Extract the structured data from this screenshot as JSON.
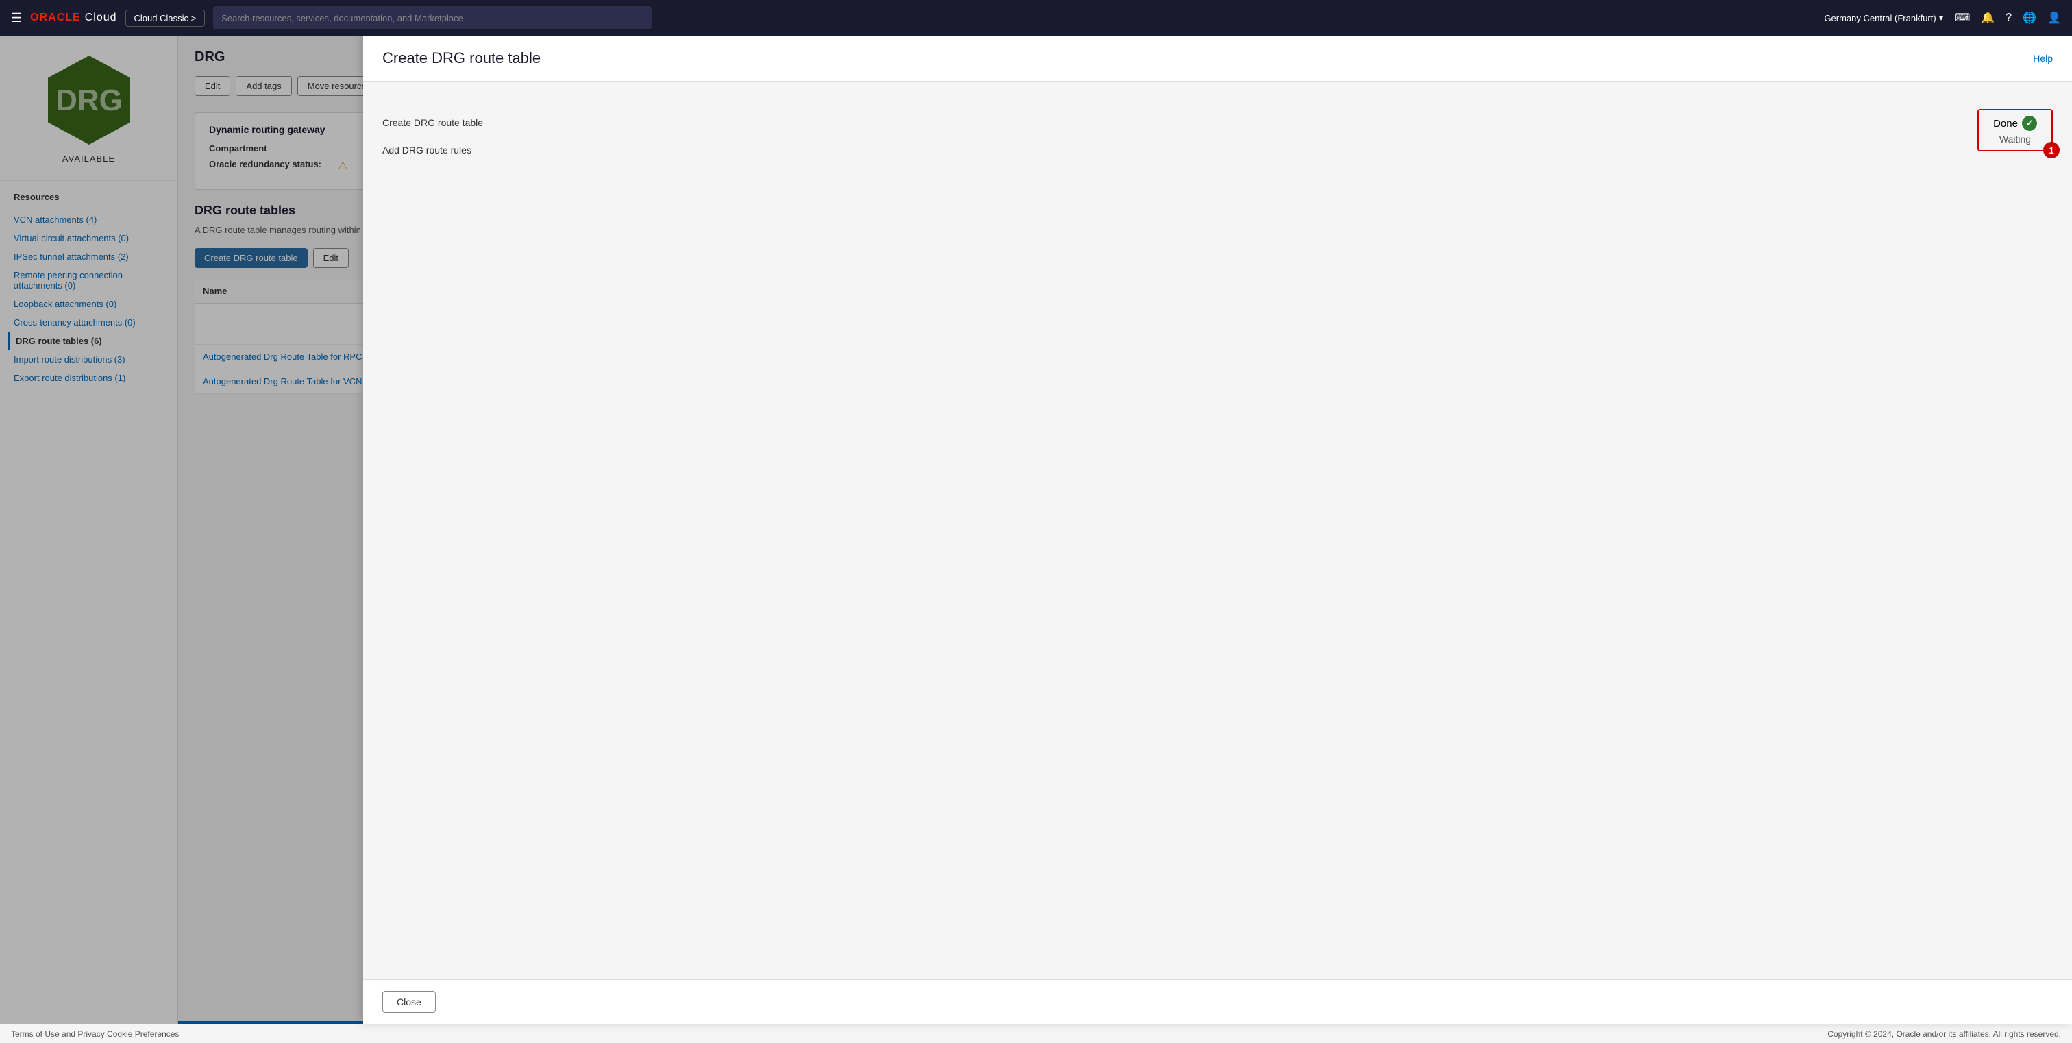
{
  "nav": {
    "hamburger_label": "☰",
    "oracle_label": "ORACLE",
    "cloud_label": "Cloud",
    "cloud_classic_label": "Cloud Classic >",
    "search_placeholder": "Search resources, services, documentation, and Marketplace",
    "region_label": "Germany Central (Frankfurt)",
    "region_chevron": "▾"
  },
  "sidebar": {
    "drg_label": "DRG",
    "status_label": "AVAILABLE",
    "resources_heading": "Resources",
    "links": [
      {
        "label": "VCN attachments (4)",
        "active": false
      },
      {
        "label": "Virtual circuit attachments (0)",
        "active": false
      },
      {
        "label": "IPSec tunnel attachments (2)",
        "active": false
      },
      {
        "label": "Remote peering connection attachments (0)",
        "active": false
      },
      {
        "label": "Loopback attachments (0)",
        "active": false
      },
      {
        "label": "Cross-tenancy attachments (0)",
        "active": false
      },
      {
        "label": "DRG route tables (6)",
        "active": true
      },
      {
        "label": "Import route distributions (3)",
        "active": false
      },
      {
        "label": "Export route distributions (1)",
        "active": false
      }
    ]
  },
  "content": {
    "page_title": "DRG",
    "action_buttons": [
      "Edit",
      "Add tags",
      "Move resource"
    ],
    "gateway_section": {
      "title": "Dynamic routing gateway",
      "compartment_label": "Compartment",
      "redundancy_label": "Oracle redundancy status:"
    },
    "route_tables": {
      "title": "DRG route tables",
      "description": "A DRG route table manages routing within a DRG, and is used to route traffic to resources of a certain type to use specific next hops.",
      "create_button": "Create DRG route table",
      "edit_button": "Edit",
      "table_headers": [
        "Name"
      ],
      "rows": [
        {
          "name": "Autogenerated Drg Route Table for RPC, VC, and IPSec attachments",
          "link": true
        },
        {
          "name": "Autogenerated Drg Route Table for VCN attachments",
          "link": true
        }
      ]
    }
  },
  "modal": {
    "title": "Create DRG route table",
    "help_label": "Help",
    "steps": [
      {
        "label": "Create DRG route table"
      },
      {
        "label": "Add DRG route rules"
      }
    ],
    "status": {
      "done_label": "Done",
      "waiting_label": "Waiting",
      "badge": "1"
    },
    "footer": {
      "close_label": "Close"
    }
  },
  "footer": {
    "left": "Terms of Use and Privacy    Cookie Preferences",
    "right": "Copyright © 2024, Oracle and/or its affiliates. All rights reserved."
  }
}
